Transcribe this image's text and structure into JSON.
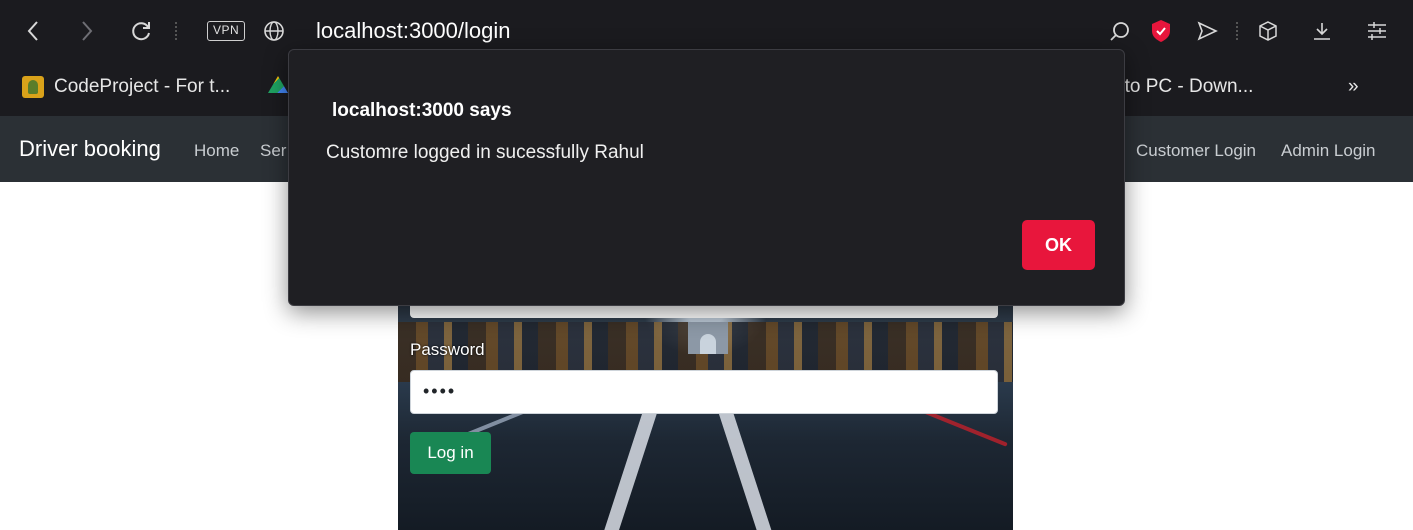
{
  "browser": {
    "address": {
      "host": "localhost",
      "path": ":3000/login"
    },
    "vpn_label": "VPN",
    "icons": [
      "back-icon",
      "forward-icon",
      "reload-icon",
      "globe-icon",
      "search-icon",
      "shield-icon",
      "send-icon",
      "cube-icon",
      "download-icon",
      "settings-icon"
    ],
    "bookmarks": [
      {
        "label": "CodeProject - For t...",
        "icon": "codeproject-favicon"
      },
      {
        "label": "",
        "icon": "drive-favicon"
      },
      {
        "label": "nto PC - Down...",
        "icon": ""
      }
    ],
    "bookmarks_overflow": "»"
  },
  "navbar": {
    "brand": "Driver booking",
    "links": [
      "Home",
      "Ser",
      "Customer Login",
      "Admin Login"
    ]
  },
  "login_form": {
    "password_label": "Password",
    "password_value": "••••",
    "submit_label": "Log in"
  },
  "dialog": {
    "title": "localhost:3000 says",
    "message": "Customre logged in sucessfully Rahul",
    "ok_label": "OK",
    "accent_color": "#e8163c"
  }
}
